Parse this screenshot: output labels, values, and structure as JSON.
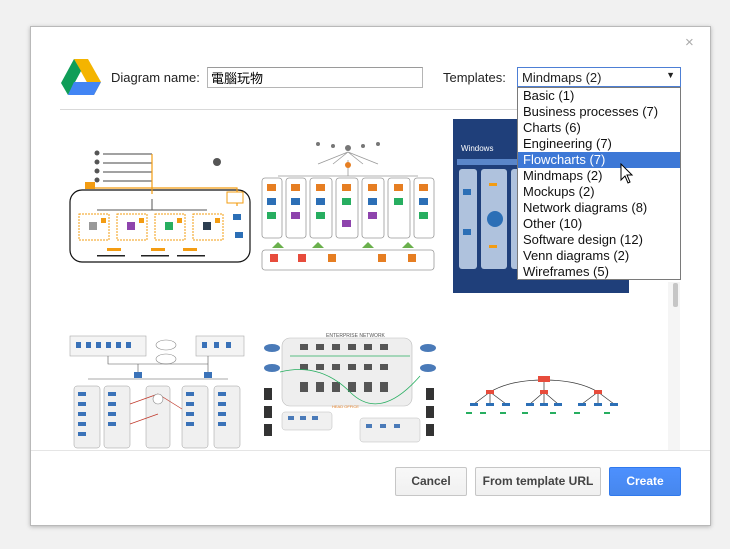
{
  "dialog": {
    "close_glyph": "×",
    "diagram_name_label": "Diagram name:",
    "diagram_name_value": "電腦玩物",
    "templates_label": "Templates:",
    "selected_template": "Mindmaps (2)",
    "dropdown_arrow": "▼",
    "template_options": [
      "Basic (1)",
      "Business processes (7)",
      "Charts (6)",
      "Engineering (7)",
      "Flowcharts (7)",
      "Mindmaps (2)",
      "Mockups (2)",
      "Network diagrams (8)",
      "Other (10)",
      "Software design (12)",
      "Venn diagrams (2)",
      "Wireframes (5)"
    ],
    "highlighted_option": "Flowcharts (7)",
    "thumb_texts": {
      "windows": "Windows",
      "enterprise": "ENTERPRISE NETWORK",
      "head_office": "HEAD OFFICE"
    },
    "buttons": {
      "cancel": "Cancel",
      "from_url": "From template URL",
      "create": "Create"
    },
    "colors": {
      "primary": "#4d90fe",
      "highlight": "#3d78d6",
      "drive_green": "#0f9d58",
      "drive_yellow": "#f4b400",
      "drive_blue": "#4285f4"
    }
  }
}
